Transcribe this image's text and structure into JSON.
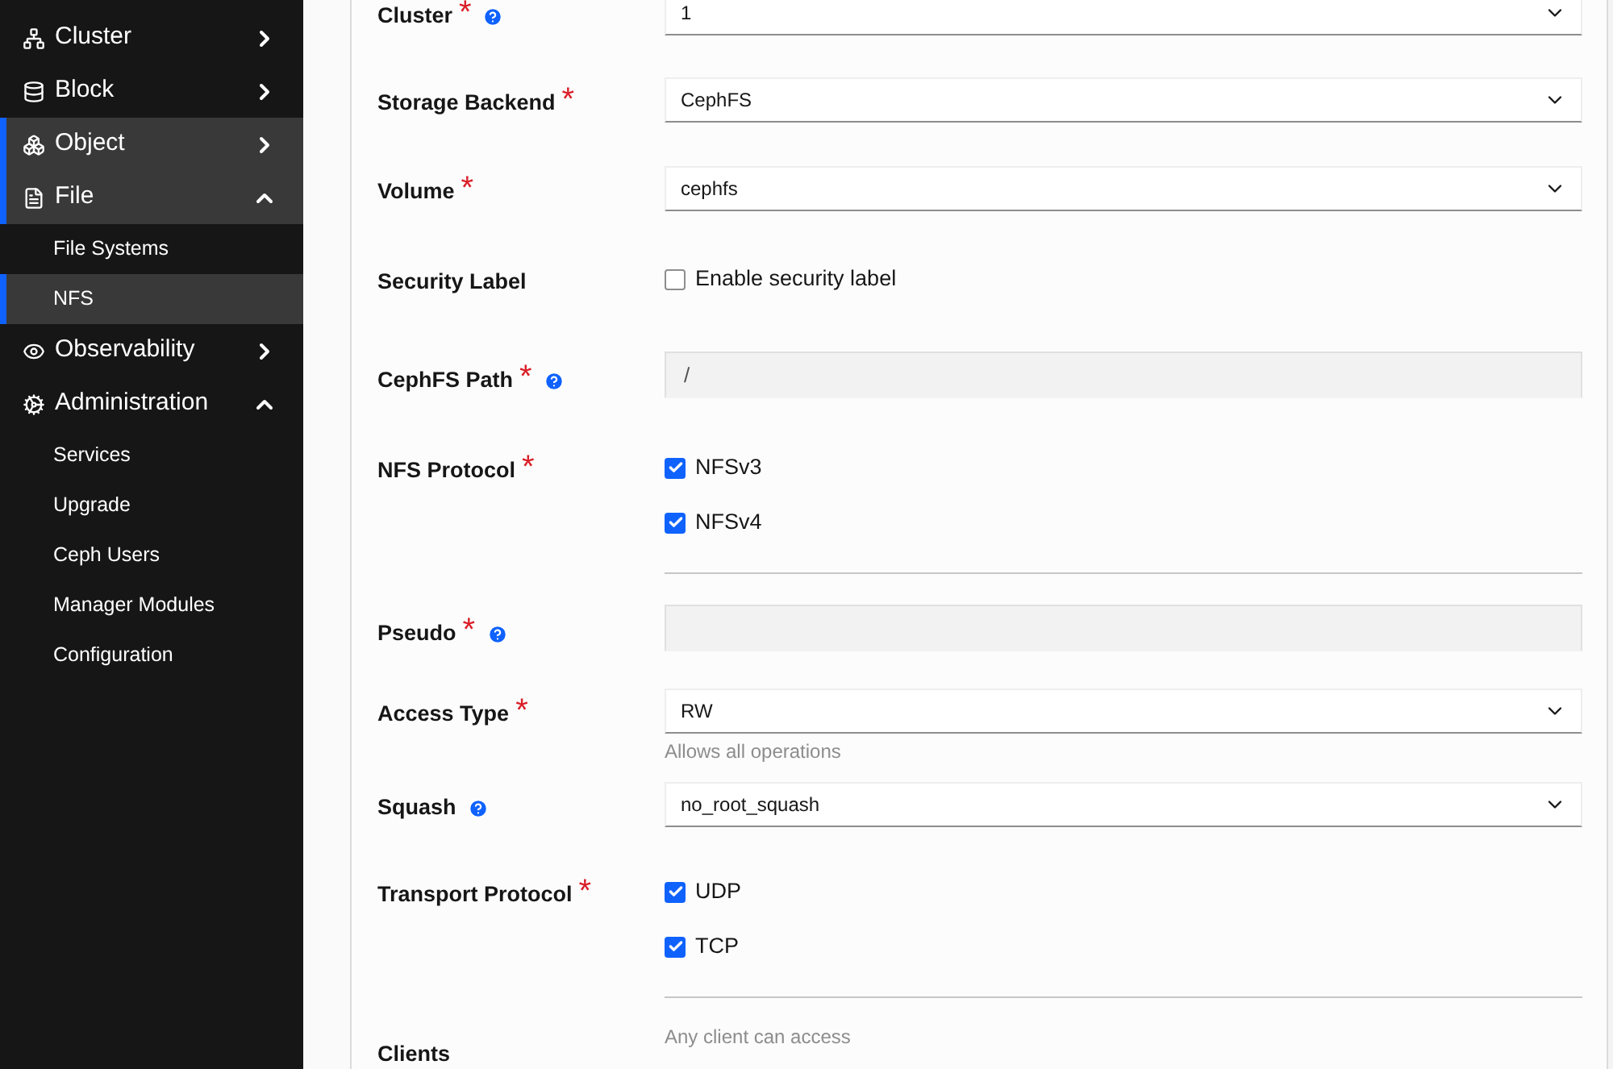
{
  "sidebar": {
    "items": [
      {
        "label": "Cluster",
        "selected": false,
        "expanded": false
      },
      {
        "label": "Block",
        "selected": false,
        "expanded": false
      },
      {
        "label": "Object",
        "selected": true,
        "expanded": false
      },
      {
        "label": "File",
        "selected": true,
        "expanded": true,
        "children": [
          {
            "label": "File Systems",
            "selected": false
          },
          {
            "label": "NFS",
            "selected": true
          }
        ]
      },
      {
        "label": "Observability",
        "selected": false,
        "expanded": false
      },
      {
        "label": "Administration",
        "selected": false,
        "expanded": true,
        "children": [
          {
            "label": "Services",
            "selected": false
          },
          {
            "label": "Upgrade",
            "selected": false
          },
          {
            "label": "Ceph Users",
            "selected": false
          },
          {
            "label": "Manager Modules",
            "selected": false
          },
          {
            "label": "Configuration",
            "selected": false
          }
        ]
      }
    ]
  },
  "form": {
    "rows": [
      {
        "kind": "select",
        "label": "Cluster",
        "required_mark": "*",
        "help": true,
        "value": "1"
      },
      {
        "kind": "select",
        "label": "Storage Backend",
        "required_mark": "*",
        "help": false,
        "value": "CephFS"
      },
      {
        "kind": "select",
        "label": "Volume",
        "required_mark": "*",
        "help": false,
        "value": "cephfs"
      },
      {
        "kind": "checkbox",
        "label": "Security Label",
        "help": false,
        "options": [
          {
            "label": "Enable security label",
            "checked": false
          }
        ]
      },
      {
        "kind": "input",
        "label": "CephFS Path",
        "required_mark": "*",
        "help": true,
        "value": "/"
      },
      {
        "kind": "checkgroup",
        "label": "NFS Protocol",
        "required_mark": "*",
        "help": false,
        "options": [
          {
            "label": "NFSv3",
            "checked": true
          },
          {
            "label": "NFSv4",
            "checked": true
          }
        ]
      },
      {
        "kind": "input",
        "label": "Pseudo",
        "required_mark": "*",
        "help": true
      },
      {
        "kind": "select",
        "label": "Access Type",
        "required_mark": "*",
        "help": false,
        "value": "RW",
        "hint": "Allows all operations"
      },
      {
        "kind": "select",
        "label": "Squash",
        "help": true,
        "value": "no_root_squash"
      },
      {
        "kind": "checkgroup",
        "label": "Transport Protocol",
        "required_mark": "*",
        "help": false,
        "options": [
          {
            "label": "UDP",
            "checked": true
          },
          {
            "label": "TCP",
            "checked": true
          }
        ]
      },
      {
        "kind": "note",
        "label": "Clients",
        "help": false,
        "hint": "Any client can access"
      }
    ]
  }
}
